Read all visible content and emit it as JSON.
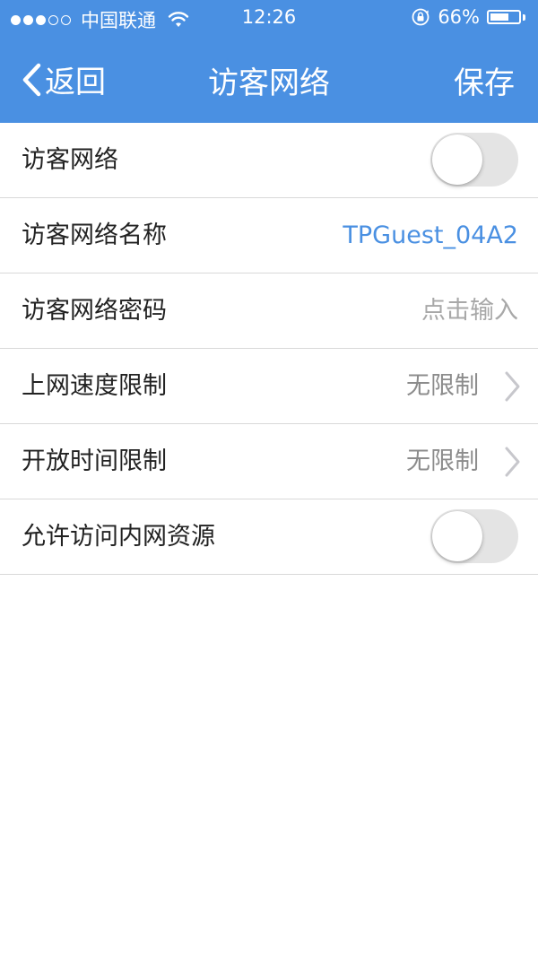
{
  "status_bar": {
    "carrier": "中国联通",
    "time": "12:26",
    "battery_percent": "66%",
    "battery_level": 0.66,
    "signal_bars_filled": 3,
    "signal_bars_total": 5
  },
  "nav": {
    "back_label": "返回",
    "title": "访客网络",
    "save_label": "保存"
  },
  "colors": {
    "header_bg": "#4a90e2",
    "value_blue": "#4a90e2",
    "placeholder_gray": "#a8a8a8"
  },
  "settings": {
    "guest_network": {
      "label": "访客网络",
      "enabled": false
    },
    "network_name": {
      "label": "访客网络名称",
      "value": "TPGuest_04A2"
    },
    "network_password": {
      "label": "访客网络密码",
      "placeholder": "点击输入"
    },
    "speed_limit": {
      "label": "上网速度限制",
      "value": "无限制"
    },
    "time_limit": {
      "label": "开放时间限制",
      "value": "无限制"
    },
    "intranet_access": {
      "label": "允许访问内网资源",
      "enabled": false
    }
  },
  "icons": {
    "back": "chevron-left-icon",
    "disclosure": "chevron-right-icon",
    "wifi": "wifi-icon",
    "orientation_lock": "orientation-lock-icon",
    "battery": "battery-icon"
  }
}
